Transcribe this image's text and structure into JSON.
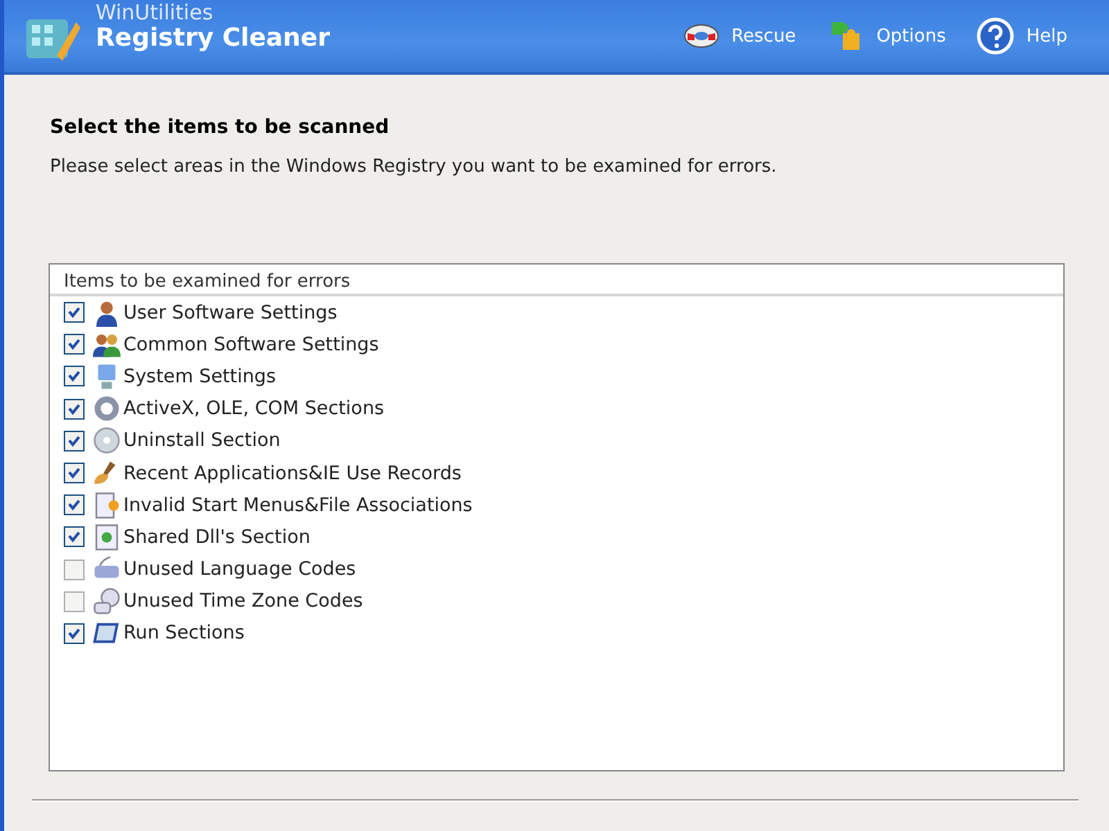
{
  "header": {
    "brand": "WinUtilities",
    "product": "Registry Cleaner",
    "actions": [
      {
        "kind": "rescue",
        "label": "Rescue"
      },
      {
        "kind": "options",
        "label": "Options"
      },
      {
        "kind": "help",
        "label": "Help"
      }
    ]
  },
  "heading": "Select the items to be scanned",
  "description": "Please select areas in the Windows Registry you want to be examined for errors.",
  "list": {
    "header": "Items to be examined for errors",
    "items": [
      {
        "label": "User Software Settings",
        "checked": true
      },
      {
        "label": "Common Software Settings",
        "checked": true
      },
      {
        "label": "System Settings",
        "checked": true
      },
      {
        "label": "ActiveX, OLE, COM Sections",
        "checked": true
      },
      {
        "label": "Uninstall Section",
        "checked": true
      },
      {
        "label": "Recent Applications&IE Use Records",
        "checked": true
      },
      {
        "label": "Invalid Start Menus&File Associations",
        "checked": true
      },
      {
        "label": "Shared Dll's Section",
        "checked": true
      },
      {
        "label": "Unused Language Codes",
        "checked": false
      },
      {
        "label": "Unused Time Zone Codes",
        "checked": false
      },
      {
        "label": "Run Sections",
        "checked": true
      }
    ]
  }
}
